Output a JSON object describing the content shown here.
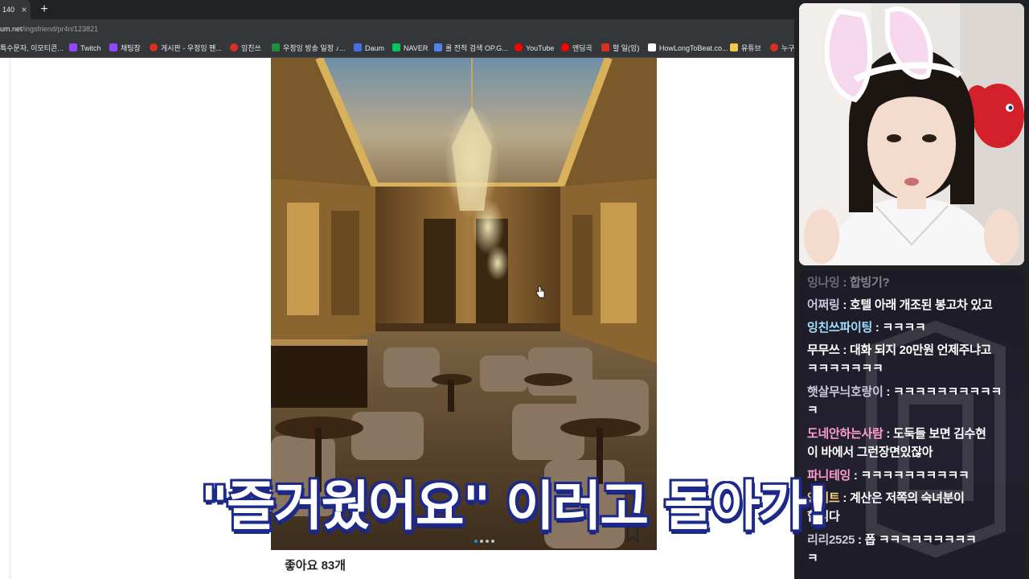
{
  "browser": {
    "tab_title": "140",
    "tab_close": "×",
    "new_tab": "+",
    "url_host": "um.net",
    "url_path": "/ingsfriend/pr4n/123821",
    "bookmarks": [
      {
        "label": "특수문자, 이모티콘...",
        "icon": "none",
        "color": "#35363a"
      },
      {
        "label": "Twitch",
        "icon": "twitch-icon",
        "color": "#9146ff"
      },
      {
        "label": "채팅창",
        "icon": "twitch-icon",
        "color": "#9146ff"
      },
      {
        "label": "게시판 - 우정잉 팬...",
        "icon": "no-entry-icon",
        "color": "#d93025"
      },
      {
        "label": "잉친쓰",
        "icon": "no-entry-icon",
        "color": "#d93025"
      },
      {
        "label": "우정잉 방송 일정 ♪...",
        "icon": "plus-icon",
        "color": "#1e8e3e"
      },
      {
        "label": "Daum",
        "icon": "daum-icon",
        "color": "#4a6ee0"
      },
      {
        "label": "NAVER",
        "icon": "naver-icon",
        "color": "#03c75a"
      },
      {
        "label": "롤 전적 검색 OP.G...",
        "icon": "opgg-icon",
        "color": "#5383e8"
      },
      {
        "label": "YouTube",
        "icon": "youtube-icon",
        "color": "#ff0000"
      },
      {
        "label": "앤딩곡",
        "icon": "youtube-icon",
        "color": "#ff0000"
      },
      {
        "label": "할 일(잉)",
        "icon": "pin-icon",
        "color": "#d93025"
      },
      {
        "label": "HowLongToBeat.co...",
        "icon": "hltb-icon",
        "color": "#ffffff"
      },
      {
        "label": "유튜브",
        "icon": "folder-icon",
        "color": "#f2c94c"
      },
      {
        "label": "누구",
        "icon": "no-entry-icon",
        "color": "#d93025"
      }
    ]
  },
  "post": {
    "likes": "좋아요 83개"
  },
  "chat": {
    "messages": [
      {
        "nick": "잉나잉",
        "text": " : 합빙기?",
        "nick_color": "#c8c8d8",
        "faded": true
      },
      {
        "nick": "어쩌링",
        "text": " : 호텔 아래 개조된 봉고차 있고",
        "nick_color": "#c8c8d8"
      },
      {
        "nick": "잉친쓰파이팅",
        "text": " : ㅋㅋㅋㅋ",
        "nick_color": "#9fe0ff"
      },
      {
        "nick": "무무쓰",
        "text": " : 대화 되지 20만원 언제주냐고",
        "nick_color": "#ffffff",
        "line2": "ㅋㅋㅋㅋㅋㅋㅋ"
      },
      {
        "nick": "햇살무늬호랑이",
        "text": " : ㅋㅋㅋㅋㅋㅋㅋㅋㅋㅋ",
        "nick_color": "#c8c8d8",
        "line2": "ㅋ"
      },
      {
        "nick": "도네안하는사람",
        "text": " : 도둑들 보면 김수현",
        "nick_color": "#ff9ecb",
        "line2": "이 바에서 그런장면있잖아"
      },
      {
        "nick": "파니테잉",
        "text": " : ㅋㅋㅋㅋㅋㅋㅋㅋㅋㅋ",
        "nick_color": "#ff9ecb"
      },
      {
        "nick": "잉이트",
        "text": " : 계산은 저쪽의 숙녀분이",
        "nick_color": "#ffd27a",
        "line2": "합니다"
      },
      {
        "nick": "리리2525",
        "text": " : 폽 ㅋㅋㅋㅋㅋㅋㅋㅋㅋ",
        "nick_color": "#c8c8d8",
        "line2": "ㅋ"
      }
    ]
  },
  "caption": {
    "text": "\"즐거웠어요\" 이러고 돌아가!"
  }
}
